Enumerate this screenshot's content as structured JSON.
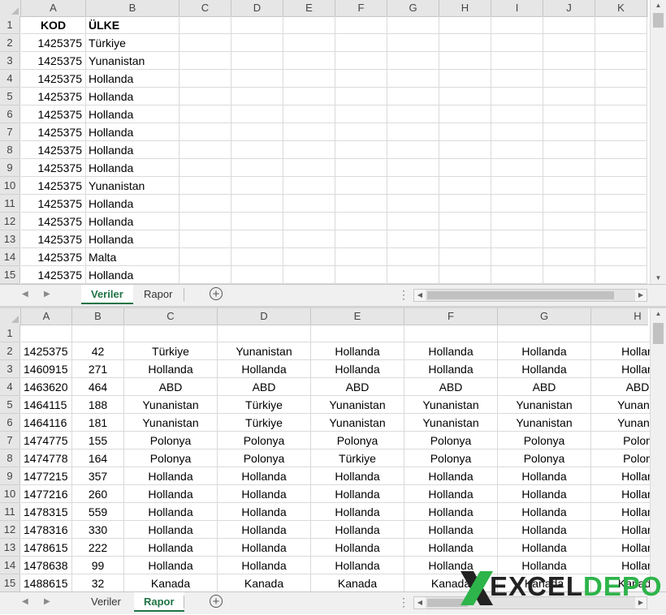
{
  "top_pane": {
    "columns": [
      "A",
      "B",
      "C",
      "D",
      "E",
      "F",
      "G",
      "H",
      "I",
      "J",
      "K"
    ],
    "rows": [
      "1",
      "2",
      "3",
      "4",
      "5",
      "6",
      "7",
      "8",
      "9",
      "10",
      "11",
      "12",
      "13",
      "14",
      "15"
    ],
    "data": [
      [
        "KOD",
        "ÜLKE"
      ],
      [
        "1425375",
        "Türkiye"
      ],
      [
        "1425375",
        "Yunanistan"
      ],
      [
        "1425375",
        "Hollanda"
      ],
      [
        "1425375",
        "Hollanda"
      ],
      [
        "1425375",
        "Hollanda"
      ],
      [
        "1425375",
        "Hollanda"
      ],
      [
        "1425375",
        "Hollanda"
      ],
      [
        "1425375",
        "Hollanda"
      ],
      [
        "1425375",
        "Yunanistan"
      ],
      [
        "1425375",
        "Hollanda"
      ],
      [
        "1425375",
        "Hollanda"
      ],
      [
        "1425375",
        "Hollanda"
      ],
      [
        "1425375",
        "Malta"
      ],
      [
        "1425375",
        "Hollanda"
      ]
    ]
  },
  "top_tabs": [
    {
      "label": "Veriler",
      "active": true
    },
    {
      "label": "Rapor",
      "active": false
    }
  ],
  "bottom_pane": {
    "columns": [
      "A",
      "B",
      "C",
      "D",
      "E",
      "F",
      "G",
      "H"
    ],
    "rows": [
      "1",
      "2",
      "3",
      "4",
      "5",
      "6",
      "7",
      "8",
      "9",
      "10",
      "11",
      "12",
      "13",
      "14",
      "15"
    ],
    "data": [
      [
        "",
        "",
        "",
        "",
        "",
        "",
        "",
        ""
      ],
      [
        "1425375",
        "42",
        "Türkiye",
        "Yunanistan",
        "Hollanda",
        "Hollanda",
        "Hollanda",
        "Hollan"
      ],
      [
        "1460915",
        "271",
        "Hollanda",
        "Hollanda",
        "Hollanda",
        "Hollanda",
        "Hollanda",
        "Hollan"
      ],
      [
        "1463620",
        "464",
        "ABD",
        "ABD",
        "ABD",
        "ABD",
        "ABD",
        "ABD"
      ],
      [
        "1464115",
        "188",
        "Yunanistan",
        "Türkiye",
        "Yunanistan",
        "Yunanistan",
        "Yunanistan",
        "Yunanis"
      ],
      [
        "1464116",
        "181",
        "Yunanistan",
        "Türkiye",
        "Yunanistan",
        "Yunanistan",
        "Yunanistan",
        "Yunanis"
      ],
      [
        "1474775",
        "155",
        "Polonya",
        "Polonya",
        "Polonya",
        "Polonya",
        "Polonya",
        "Polon"
      ],
      [
        "1474778",
        "164",
        "Polonya",
        "Polonya",
        "Türkiye",
        "Polonya",
        "Polonya",
        "Polon"
      ],
      [
        "1477215",
        "357",
        "Hollanda",
        "Hollanda",
        "Hollanda",
        "Hollanda",
        "Hollanda",
        "Hollan"
      ],
      [
        "1477216",
        "260",
        "Hollanda",
        "Hollanda",
        "Hollanda",
        "Hollanda",
        "Hollanda",
        "Hollan"
      ],
      [
        "1478315",
        "559",
        "Hollanda",
        "Hollanda",
        "Hollanda",
        "Hollanda",
        "Hollanda",
        "Hollan"
      ],
      [
        "1478316",
        "330",
        "Hollanda",
        "Hollanda",
        "Hollanda",
        "Hollanda",
        "Hollanda",
        "Hollan"
      ],
      [
        "1478615",
        "222",
        "Hollanda",
        "Hollanda",
        "Hollanda",
        "Hollanda",
        "Hollanda",
        "Hollan"
      ],
      [
        "1478638",
        "99",
        "Hollanda",
        "Hollanda",
        "Hollanda",
        "Hollanda",
        "Hollanda",
        "Hollan"
      ],
      [
        "1488615",
        "32",
        "Kanada",
        "Kanada",
        "Kanada",
        "Kanada",
        "Kanada",
        "Kanada"
      ]
    ]
  },
  "bottom_tabs": [
    {
      "label": "Veriler",
      "active": false
    },
    {
      "label": "Rapor",
      "active": true
    }
  ],
  "icons": {
    "add_sheet": "plus-circle-icon",
    "tab_options": "vertical-dots-icon",
    "nav_prev": "triangle-left-icon",
    "nav_next": "triangle-right-icon"
  },
  "colors": {
    "accent": "#217346",
    "logo_dark": "#222222",
    "logo_green": "#2db44a"
  },
  "logo": {
    "part1": "EXCEL",
    "part2": "DEPO"
  }
}
